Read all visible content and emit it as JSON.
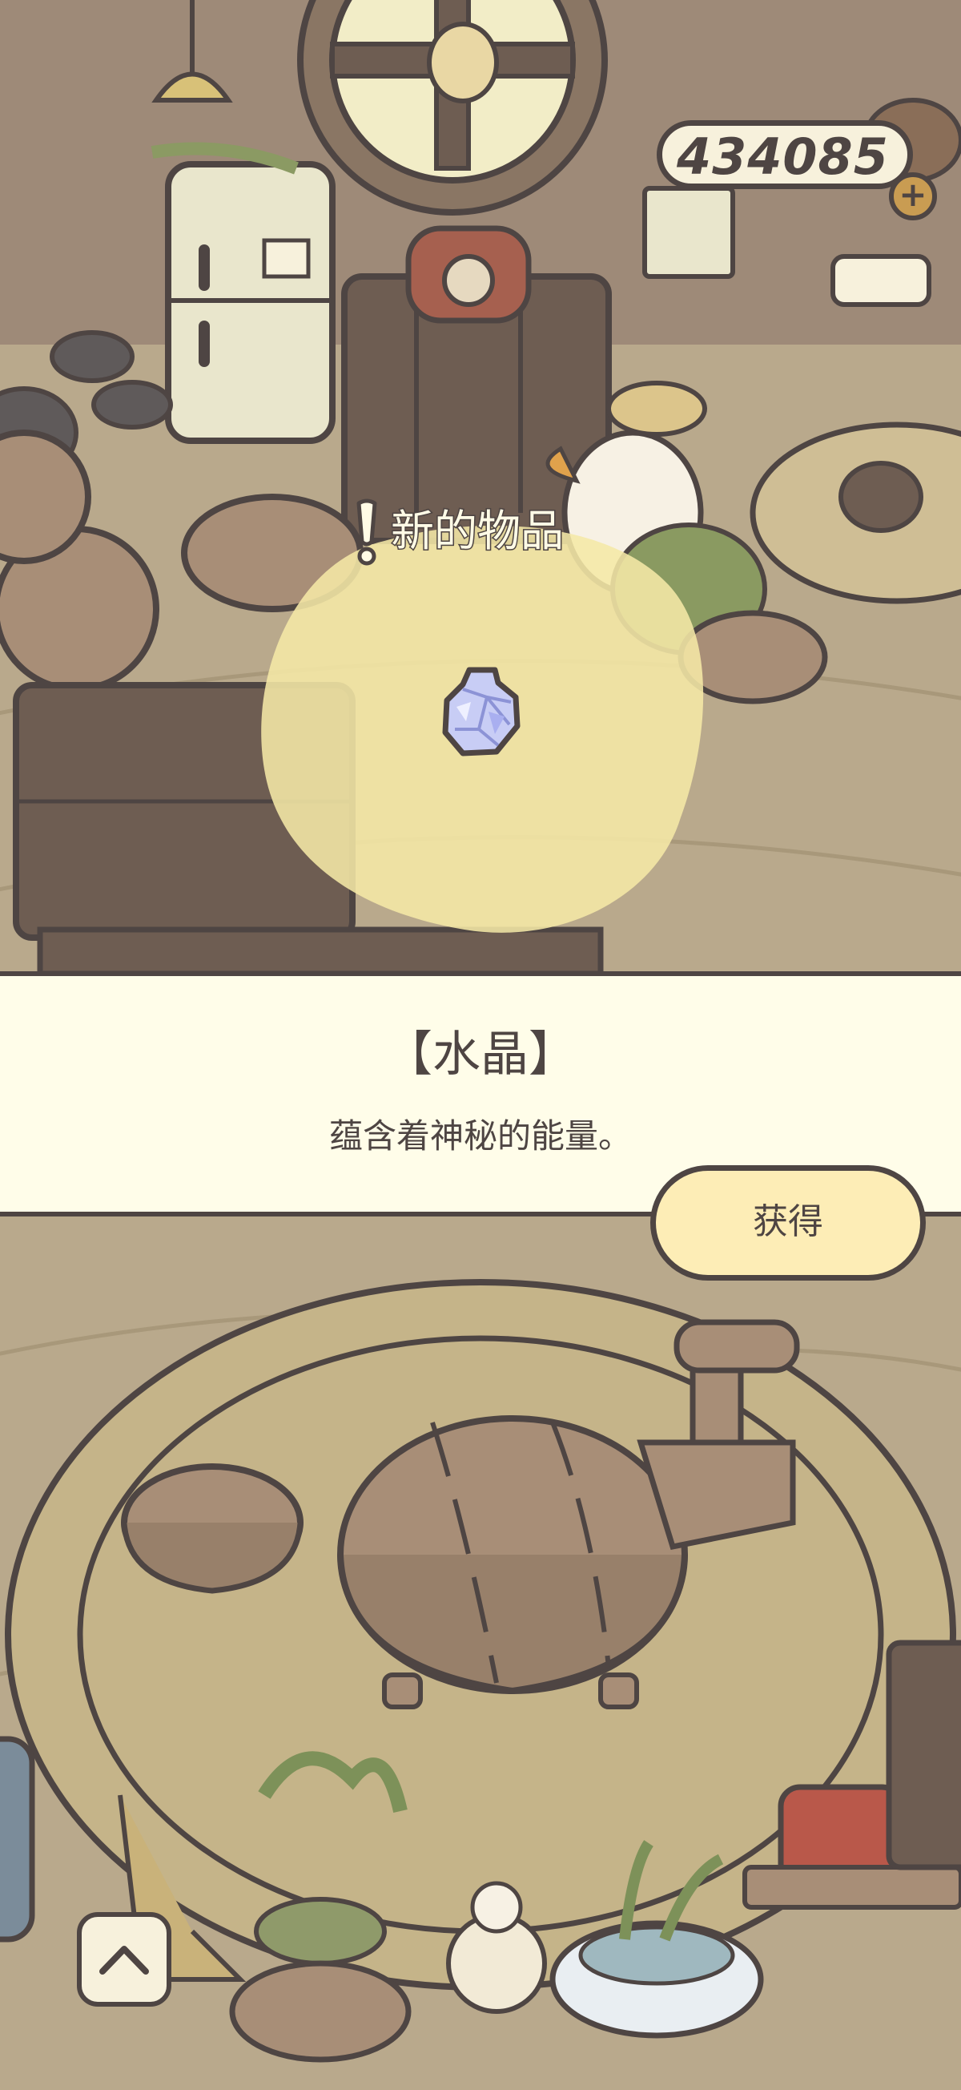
{
  "hud": {
    "coins": "434085",
    "add_coins_symbol": "+"
  },
  "notification": {
    "new_item_text": "新的物品",
    "icon": "exclamation-icon"
  },
  "dialog": {
    "item_name": "【水晶】",
    "item_description": "蕴含着神秘的能量。",
    "obtain_label": "获得",
    "item_icon": "crystal-icon"
  },
  "controls": {
    "collapse_icon": "chevron-up-icon"
  },
  "colors": {
    "outline": "#4e4543",
    "floor": "#b8a78a",
    "dialog_bg": "#fffde9",
    "button_bg": "#fdedb6",
    "highlight_blob": "#f5e8a6"
  }
}
